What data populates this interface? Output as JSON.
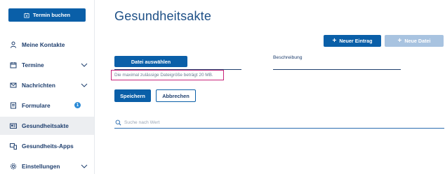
{
  "sidebar": {
    "book_button": "Termin buchen",
    "items": [
      {
        "label": "Meine Kontakte",
        "icon": "contacts-icon"
      },
      {
        "label": "Termine",
        "icon": "calendar-icon",
        "expandable": true
      },
      {
        "label": "Nachrichten",
        "icon": "mail-icon",
        "expandable": true
      },
      {
        "label": "Formulare",
        "icon": "form-icon",
        "badge": "1"
      },
      {
        "label": "Gesundheitsakte",
        "icon": "health-record-icon",
        "active": true
      },
      {
        "label": "Gesundheits-Apps",
        "icon": "apps-icon"
      },
      {
        "label": "Einstellungen",
        "icon": "settings-icon",
        "expandable": true
      }
    ]
  },
  "main": {
    "title": "Gesundheitsakte",
    "new_entry_button": "Neuer Eintrag",
    "new_file_button": "Neue Datei",
    "choose_file_button": "Datei auswählen",
    "description_label": "Beschreibung",
    "size_note": "Die maximal zulässige Dateigröße beträgt 20 MB.",
    "save_button": "Speichern",
    "cancel_button": "Abbrechen",
    "search_placeholder": "Suche nach Wert"
  },
  "colors": {
    "primary": "#0a5fa8",
    "primary_disabled": "#a8c3e0",
    "text": "#1f3f6e",
    "highlight_border": "#c8247a",
    "badge": "#2a8ad6"
  }
}
